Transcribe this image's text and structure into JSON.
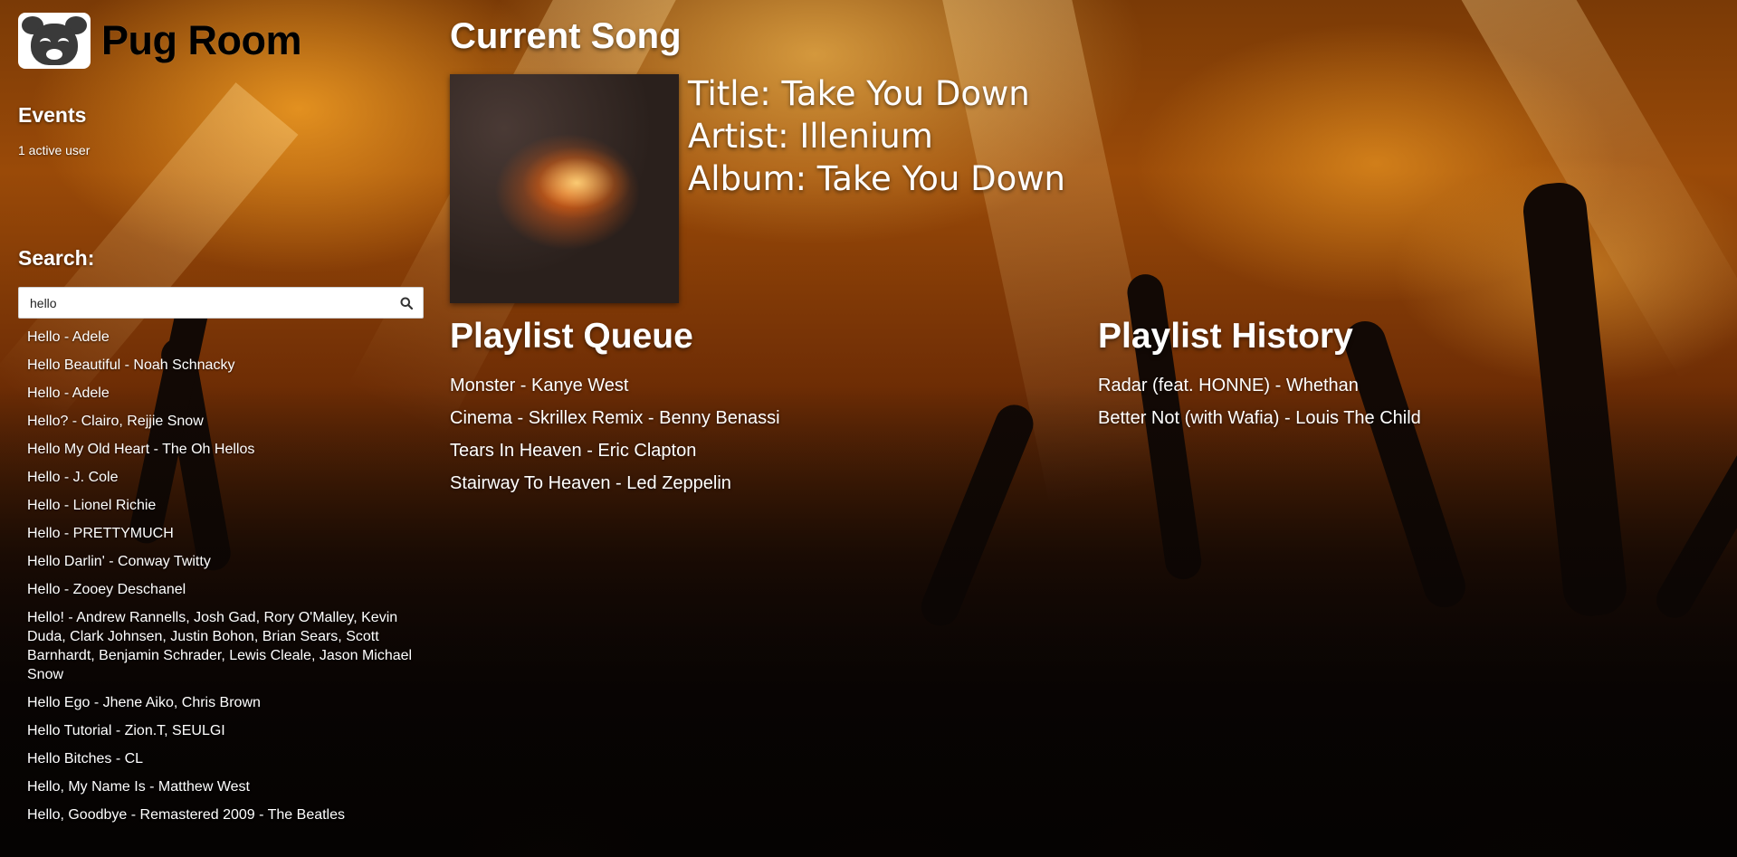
{
  "brand": {
    "name": "Pug Room"
  },
  "events": {
    "title": "Events",
    "active_users": "1 active user"
  },
  "search": {
    "title": "Search:",
    "query": "hello",
    "results": [
      "Hello - Adele",
      "Hello Beautiful - Noah Schnacky",
      "Hello - Adele",
      "Hello? - Clairo, Rejjie Snow",
      "Hello My Old Heart - The Oh Hellos",
      "Hello - J. Cole",
      "Hello - Lionel Richie",
      "Hello - PRETTYMUCH",
      "Hello Darlin' - Conway Twitty",
      "Hello - Zooey Deschanel",
      "Hello! - Andrew Rannells, Josh Gad, Rory O'Malley, Kevin Duda, Clark Johnsen, Justin Bohon, Brian Sears, Scott Barnhardt, Benjamin Schrader, Lewis Cleale, Jason Michael Snow",
      "Hello Ego - Jhene Aiko, Chris Brown",
      "Hello Tutorial - Zion.T, SEULGI",
      "Hello Bitches - CL",
      "Hello, My Name Is - Matthew West",
      "Hello, Goodbye - Remastered 2009 - The Beatles"
    ]
  },
  "current_song": {
    "heading": "Current Song",
    "title_line": "Title: Take You Down",
    "artist_line": "Artist: Illenium",
    "album_line": "Album: Take You Down"
  },
  "playlist_queue": {
    "heading": "Playlist Queue",
    "items": [
      "Monster - Kanye West",
      "Cinema - Skrillex Remix - Benny Benassi",
      "Tears In Heaven - Eric Clapton",
      "Stairway To Heaven - Led Zeppelin"
    ]
  },
  "playlist_history": {
    "heading": "Playlist History",
    "items": [
      "Radar (feat. HONNE) - Whethan",
      "Better Not (with Wafia) - Louis The Child"
    ]
  },
  "icons": {
    "search": "search-icon",
    "logo": "pug-logo-icon"
  }
}
